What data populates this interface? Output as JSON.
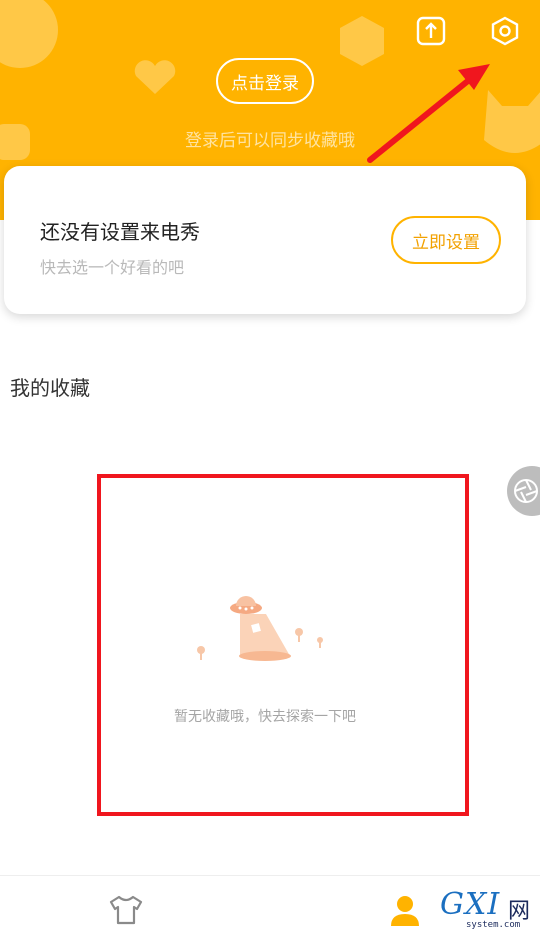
{
  "header": {
    "login_button": "点击登录",
    "login_hint": "登录后可以同步收藏哦",
    "share_icon": "upload-icon",
    "settings_icon": "hexagon-settings-icon",
    "background_color": "#FFB300"
  },
  "ringtone_card": {
    "title": "还没有设置来电秀",
    "subtitle": "快去选一个好看的吧",
    "action_button": "立即设置"
  },
  "favorites": {
    "section_title": "我的收藏",
    "empty_text": "暂无收藏哦，快去探索一下吧",
    "empty_icon": "ufo-illustration"
  },
  "tabbar": {
    "tabs": [
      {
        "icon": "tshirt-icon",
        "active": false
      },
      {
        "icon": "person-icon",
        "active": true
      }
    ]
  },
  "watermark": {
    "brand": "GXI",
    "brand_cn": "网",
    "domain": "system.com"
  },
  "annotations": {
    "arrow_color": "#F0161E",
    "highlight_color": "#F0161E"
  }
}
